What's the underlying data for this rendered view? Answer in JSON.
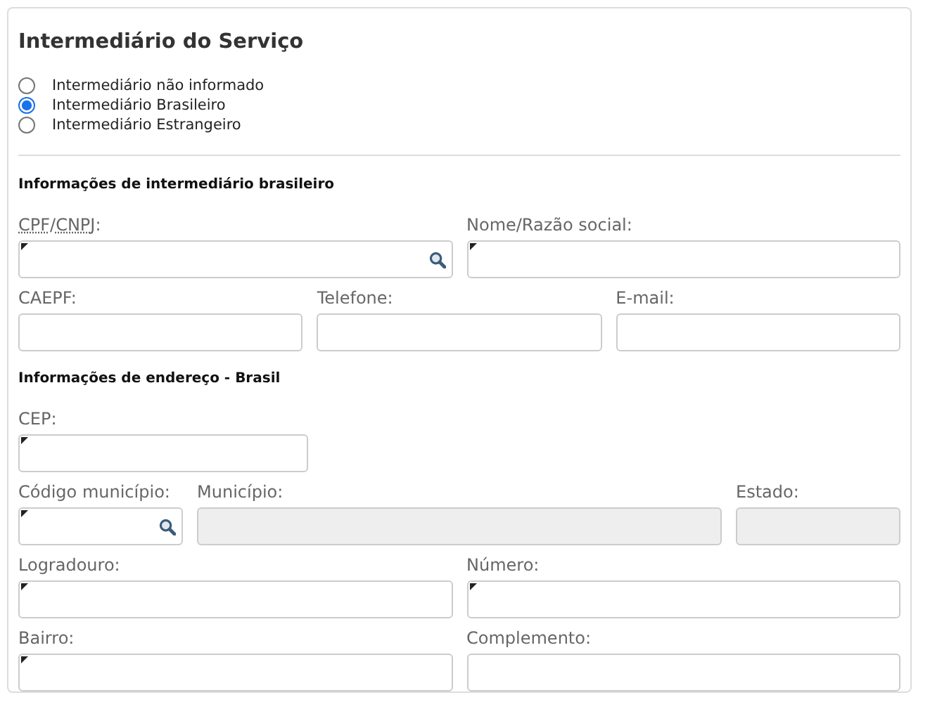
{
  "title": "Intermediário do Serviço",
  "options": [
    {
      "label": "Intermediário não informado",
      "selected": false
    },
    {
      "label": "Intermediário Brasileiro",
      "selected": true
    },
    {
      "label": "Intermediário Estrangeiro",
      "selected": false
    }
  ],
  "sections": [
    {
      "heading": "Informações de intermediário brasileiro",
      "rows": [
        [
          {
            "label_parts": [
              {
                "text": "CPF",
                "abbr": true
              },
              {
                "text": "/",
                "abbr": false
              },
              {
                "text": "CNPJ",
                "abbr": true
              },
              {
                "text": ":",
                "abbr": false
              }
            ],
            "required": true,
            "search": true,
            "disabled": false
          },
          {
            "label_parts": [
              {
                "text": "Nome/Razão social:",
                "abbr": false
              }
            ],
            "required": true,
            "search": false,
            "disabled": false
          }
        ],
        [
          {
            "label_parts": [
              {
                "text": "CAEPF:",
                "abbr": false
              }
            ],
            "required": false,
            "search": false,
            "disabled": false
          },
          {
            "label_parts": [
              {
                "text": "Telefone:",
                "abbr": false
              }
            ],
            "required": false,
            "search": false,
            "disabled": false
          },
          {
            "label_parts": [
              {
                "text": "E-mail:",
                "abbr": false
              }
            ],
            "required": false,
            "search": false,
            "disabled": false
          }
        ]
      ]
    },
    {
      "heading": "Informações de endereço - Brasil",
      "rows": [
        [
          {
            "label_parts": [
              {
                "text": "CEP:",
                "abbr": false
              }
            ],
            "required": true,
            "search": false,
            "disabled": false
          }
        ],
        [
          {
            "label_parts": [
              {
                "text": "Código município:",
                "abbr": false
              }
            ],
            "required": true,
            "search": true,
            "disabled": false
          },
          {
            "label_parts": [
              {
                "text": "Município:",
                "abbr": false
              }
            ],
            "required": false,
            "search": false,
            "disabled": true
          },
          {
            "label_parts": [
              {
                "text": "Estado:",
                "abbr": false
              }
            ],
            "required": false,
            "search": false,
            "disabled": true
          }
        ],
        [
          {
            "label_parts": [
              {
                "text": "Logradouro:",
                "abbr": false
              }
            ],
            "required": true,
            "search": false,
            "disabled": false
          },
          {
            "label_parts": [
              {
                "text": "Número:",
                "abbr": false
              }
            ],
            "required": true,
            "search": false,
            "disabled": false
          }
        ],
        [
          {
            "label_parts": [
              {
                "text": "Bairro:",
                "abbr": false
              }
            ],
            "required": true,
            "search": false,
            "disabled": false
          },
          {
            "label_parts": [
              {
                "text": "Complemento:",
                "abbr": false
              }
            ],
            "required": false,
            "search": false,
            "disabled": false
          }
        ]
      ]
    }
  ]
}
